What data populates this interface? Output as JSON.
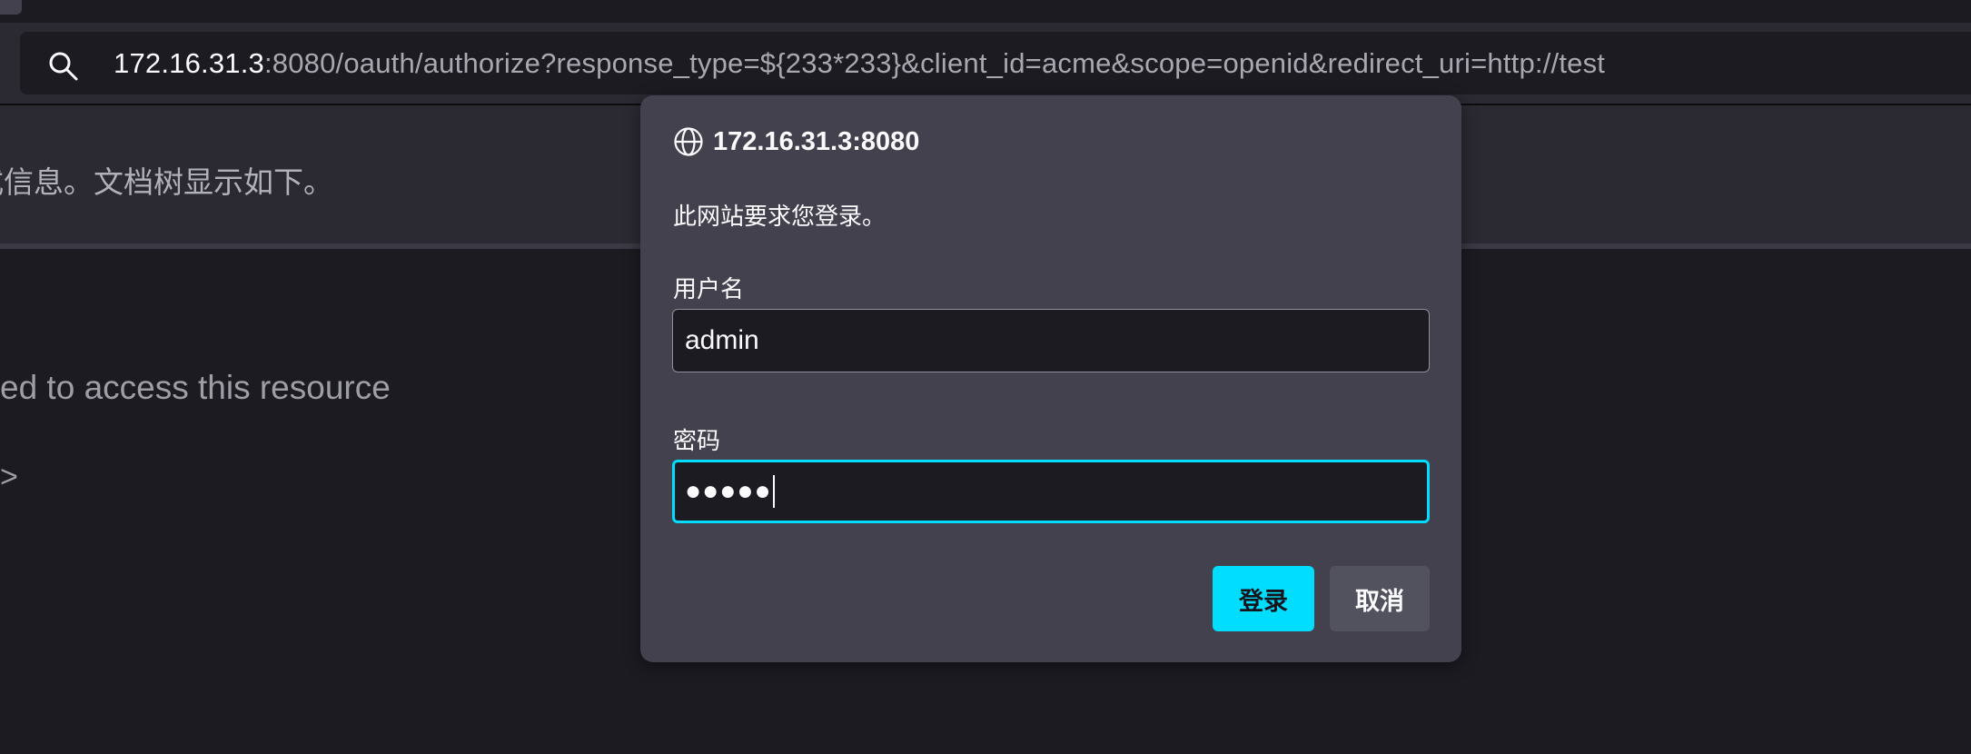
{
  "browser": {
    "url_host": "172.16.31.3",
    "url_rest": ":8080/oauth/authorize?response_type=${233*233}&client_id=acme&scope=openid&redirect_uri=http://test",
    "search_icon": "search-icon"
  },
  "page": {
    "info_text": "样式信息。文档树显示如下。",
    "error_text": "ed to access this resource",
    "gt_text": ">"
  },
  "dialog": {
    "origin": "172.16.31.3:8080",
    "origin_icon": "globe-icon",
    "message": "此网站要求您登录。",
    "username_label": "用户名",
    "username_value": "admin",
    "password_label": "密码",
    "password_mask": "●●●●●",
    "login_label": "登录",
    "cancel_label": "取消",
    "accent_color": "#00ddff"
  }
}
